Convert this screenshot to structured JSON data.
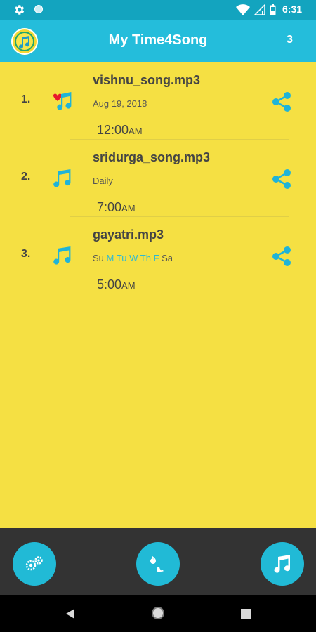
{
  "status_bar": {
    "time": "6:31"
  },
  "app_bar": {
    "title": "My Time4Song",
    "count": "3"
  },
  "songs": [
    {
      "index": "1.",
      "name": "vishnu_song.mp3",
      "schedule": "Aug 19, 2018",
      "time": "12:00",
      "ampm": "AM",
      "favorite": true
    },
    {
      "index": "2.",
      "name": "sridurga_song.mp3",
      "schedule": "Daily",
      "time": "7:00",
      "ampm": "AM",
      "favorite": false
    },
    {
      "index": "3.",
      "name": "gayatri.mp3",
      "schedule": "",
      "time": "5:00",
      "ampm": "AM",
      "favorite": false,
      "days": [
        {
          "label": "Su",
          "active": false
        },
        {
          "label": "M",
          "active": true
        },
        {
          "label": "Tu",
          "active": true
        },
        {
          "label": "W",
          "active": true
        },
        {
          "label": "Th",
          "active": true
        },
        {
          "label": "F",
          "active": true
        },
        {
          "label": "Sa",
          "active": false
        }
      ]
    }
  ],
  "colors": {
    "accent": "#21bad6",
    "background": "#f5e043",
    "active_day": "#2bb9d6"
  },
  "icons": {
    "bottom_left": "settings-gears-icon",
    "bottom_center": "quotes-icon",
    "bottom_right": "music-note-icon"
  }
}
